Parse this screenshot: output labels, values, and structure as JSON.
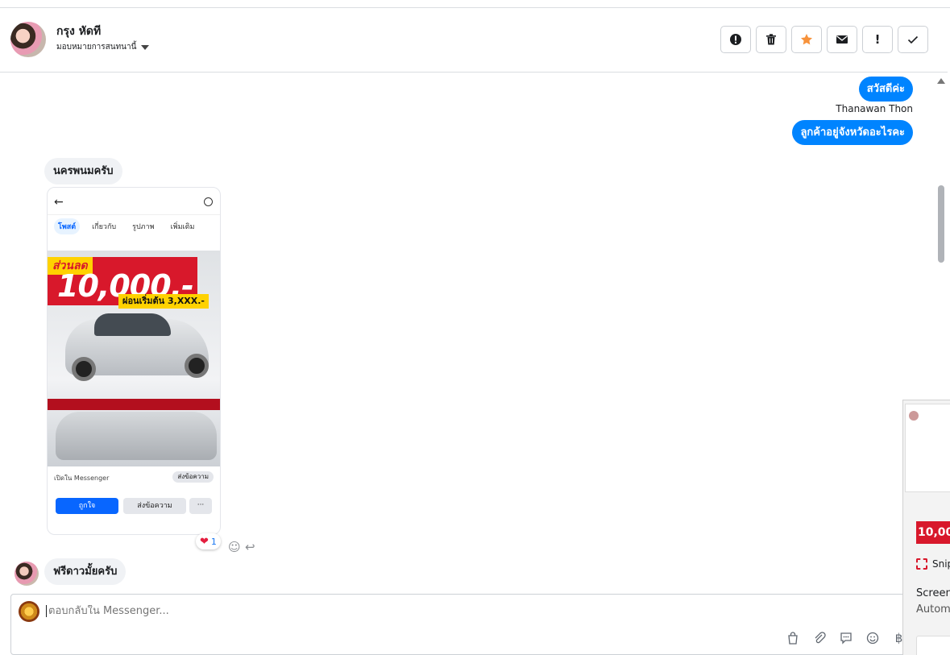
{
  "header": {
    "contact_name": "กรุง หัดที",
    "assign_label": "มอบหมายการสนทนานี้",
    "actions": [
      {
        "name": "spam-button",
        "icon": "alert-circle-icon"
      },
      {
        "name": "delete-button",
        "icon": "trash-icon"
      },
      {
        "name": "star-button",
        "icon": "star-icon"
      },
      {
        "name": "mark-unread-button",
        "icon": "envelope-icon"
      },
      {
        "name": "follow-up-button",
        "label": "!"
      },
      {
        "name": "done-button",
        "icon": "check-icon"
      }
    ]
  },
  "messages": {
    "out_1": "สวัสดีค่ะ",
    "sender_name": "Thanawan Thon",
    "out_2": "ลูกค้าอยู่จังหวัดอะไรคะ",
    "in_1": "นครพนมครับ",
    "in_2": "ฟรีดาวมั้ยครับ",
    "reaction_count": "1"
  },
  "shared_post": {
    "tabs": [
      "โพสต์",
      "เกี่ยวกับ",
      "รูปภาพ",
      "เพิ่มเติม"
    ],
    "discount_label": "ส่วนลด",
    "price": "10,000.-",
    "installment": "ผ่อนเริ่มต้น 3,XXX.-",
    "open_in_messenger": "เปิดใน Messenger",
    "send_message_pill": "ส่งข้อความ",
    "like_button": "ถูกใจ",
    "message_button": "ส่งข้อความ",
    "more_button": "···"
  },
  "composer": {
    "placeholder": "ตอบกลับใน Messenger..."
  },
  "side_panel": {
    "price_snippet": "10,00",
    "snip_label": "Snip",
    "screen_label": "Screen",
    "auto_label": "Autom"
  },
  "colors": {
    "accent": "#0084ff",
    "star": "#f7923b",
    "promo_red": "#d8182b",
    "promo_yellow": "#ffd200"
  }
}
